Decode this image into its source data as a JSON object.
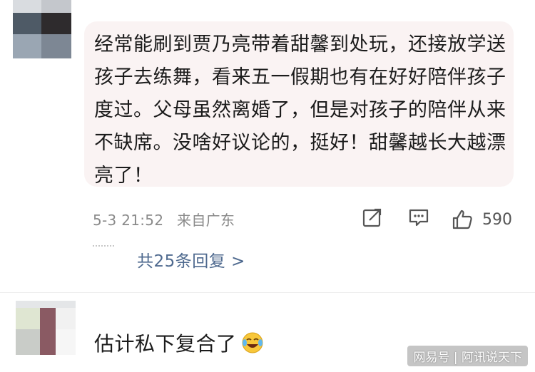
{
  "comment1": {
    "text": "经常能刷到贾乃亮带着甜馨到处玩，还接放学送孩子去练舞，看来五一假期也有在好好陪伴孩子度过。父母虽然离婚了，但是对孩子的陪伴从来不缺席。没啥好议论的，挺好！甜馨越长大越漂亮了！",
    "date": "5-3 21:52",
    "location": "来自广东",
    "likes": "590",
    "replies_label": "共25条回复 >"
  },
  "comment2": {
    "text": "估计私下复合了",
    "emoji": "crying-laughing-emoji"
  },
  "icons": {
    "share": "share-edit-icon",
    "comment": "comment-bubble-icon",
    "like": "thumbs-up-icon"
  },
  "colors": {
    "bubble_bg": "#faf3f3",
    "reply_link": "#4f6a8f",
    "meta_text": "#8a8a8a"
  },
  "watermark": "网易号 | 阿讯说天下"
}
